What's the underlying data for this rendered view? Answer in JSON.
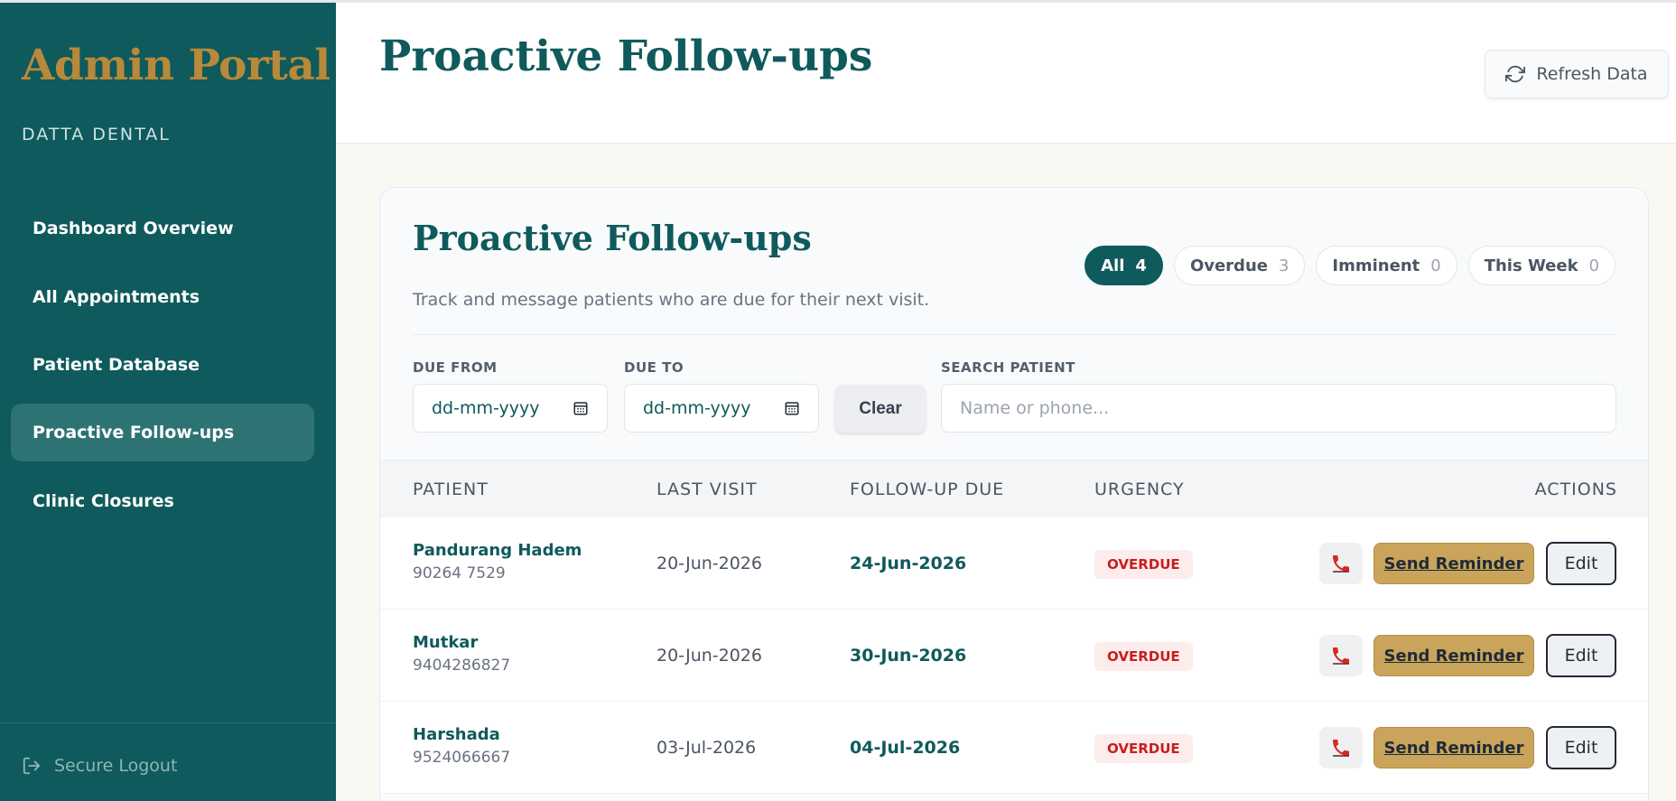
{
  "sidebar": {
    "brand": "Admin Portal",
    "clinic_name": "DATTA DENTAL",
    "nav": [
      {
        "label": "Dashboard Overview",
        "active": false
      },
      {
        "label": "All Appointments",
        "active": false
      },
      {
        "label": "Patient Database",
        "active": false
      },
      {
        "label": "Proactive Follow-ups",
        "active": true
      },
      {
        "label": "Clinic Closures",
        "active": false
      }
    ],
    "logout_label": "Secure Logout"
  },
  "header": {
    "title": "Proactive Follow-ups",
    "refresh_label": "Refresh Data"
  },
  "card": {
    "title": "Proactive Follow-ups",
    "subtitle": "Track and message patients who are due for their next visit.",
    "filters": [
      {
        "label": "All",
        "count": "4",
        "active": true
      },
      {
        "label": "Overdue",
        "count": "3",
        "active": false
      },
      {
        "label": "Imminent",
        "count": "0",
        "active": false
      },
      {
        "label": "This Week",
        "count": "0",
        "active": false
      }
    ],
    "due_from": {
      "label": "DUE FROM",
      "placeholder": "dd-mm-yyyy"
    },
    "due_to": {
      "label": "DUE TO",
      "placeholder": "dd-mm-yyyy"
    },
    "clear_label": "Clear",
    "search": {
      "label": "SEARCH PATIENT",
      "placeholder": "Name or phone..."
    }
  },
  "table": {
    "columns": [
      "PATIENT",
      "LAST VISIT",
      "FOLLOW-UP DUE",
      "URGENCY",
      "ACTIONS"
    ],
    "rows": [
      {
        "name": "Pandurang Hadem",
        "phone": "90264 7529",
        "last_visit": "20-Jun-2026",
        "due": "24-Jun-2026",
        "urgency": "OVERDUE"
      },
      {
        "name": "Mutkar",
        "phone": "9404286827",
        "last_visit": "20-Jun-2026",
        "due": "30-Jun-2026",
        "urgency": "OVERDUE"
      },
      {
        "name": "Harshada",
        "phone": "9524066667",
        "last_visit": "03-Jul-2026",
        "due": "04-Jul-2026",
        "urgency": "OVERDUE"
      }
    ],
    "reminder_label": "Send Reminder",
    "edit_label": "Edit"
  },
  "colors": {
    "sidebar_bg": "#0f5a5c",
    "brand_gold": "#b8893a",
    "accent_teal": "#0f5a5c",
    "reminder_gold": "#c9a45a",
    "overdue_red": "#c81e1e"
  },
  "icons": {
    "refresh": "refresh-icon",
    "logout": "logout-icon",
    "calendar": "calendar-icon",
    "call": "phone-icon"
  }
}
